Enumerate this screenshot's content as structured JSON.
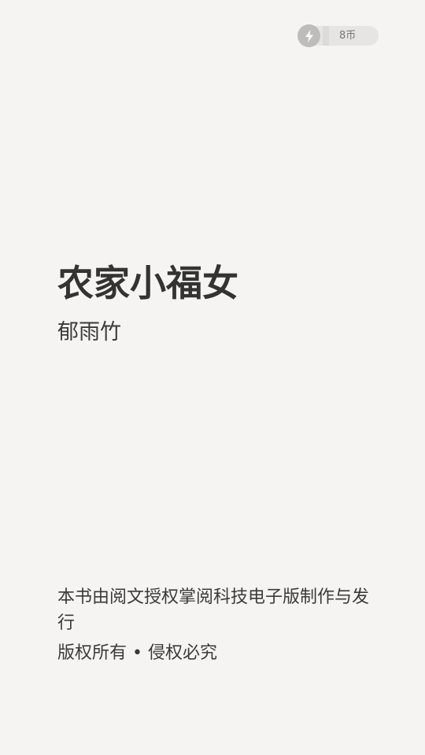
{
  "coin_balance": {
    "icon": "lightning-icon",
    "label": "8币"
  },
  "book": {
    "title": "农家小福女",
    "author": "郁雨竹"
  },
  "notice": {
    "license": "本书由阅文授权掌阅科技电子版制作与发行",
    "copyright": "版权所有 • 侵权必究"
  },
  "colors": {
    "background": "#f5f4f2",
    "text": "#333333",
    "badge": "#bdbcbb",
    "pill": "#e6e5e3"
  }
}
